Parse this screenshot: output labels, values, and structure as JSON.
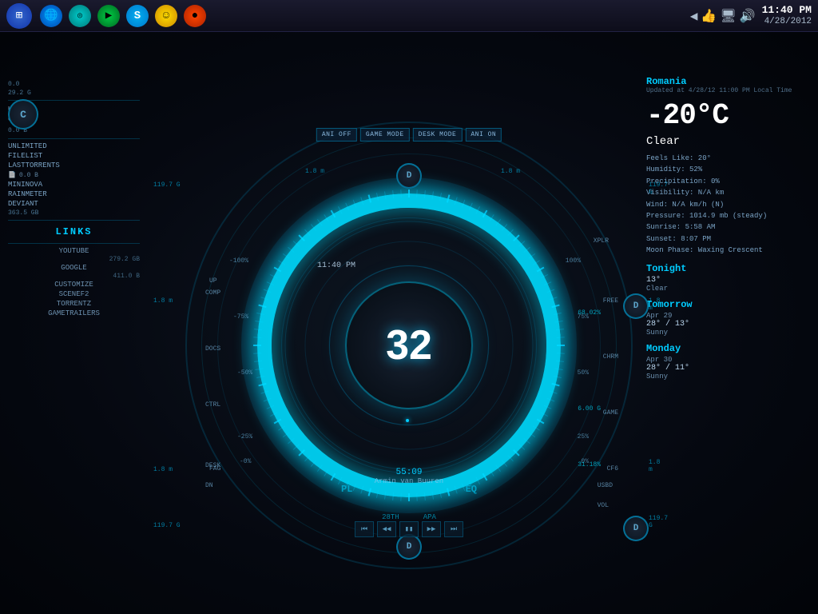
{
  "taskbar": {
    "start_icon": "⊞",
    "icons": [
      {
        "name": "ie-icon",
        "symbol": "🌐",
        "color": "blue"
      },
      {
        "name": "app2-icon",
        "symbol": "◎",
        "color": "teal"
      },
      {
        "name": "play-icon",
        "symbol": "▶",
        "color": "green"
      },
      {
        "name": "skype-icon",
        "symbol": "S",
        "color": "skype"
      },
      {
        "name": "emoji-icon",
        "symbol": "☺",
        "color": "yellow"
      },
      {
        "name": "record-icon",
        "symbol": "●",
        "color": "red"
      }
    ]
  },
  "clock": {
    "time": "11:40 PM",
    "date": "4/28/2012"
  },
  "hud": {
    "center_number": "32",
    "time_display": "11:40  PM",
    "track_time": "55:09",
    "track_artist": "Armin van Buuren",
    "track_title": "28TH  APA",
    "buttons": [
      {
        "label": "ANI OFF"
      },
      {
        "label": "GAME MODE"
      },
      {
        "label": "DESK MODE"
      },
      {
        "label": "ANI ON"
      }
    ],
    "left_labels": {
      "comp": "COMP",
      "docs": "DOCS",
      "ctrl": "CTRL",
      "fag": "FAG",
      "dn": "DN",
      "desk": "DESK",
      "up": "UP"
    },
    "right_labels": {
      "xplr": "XPLR",
      "chrm": "CHRM",
      "game": "GAME",
      "cf6": "CF6",
      "usbd": "USBD",
      "vol": "VOL",
      "free": "FREE"
    },
    "d_circles": [
      {
        "pos": "top",
        "label": "D"
      },
      {
        "pos": "right-top",
        "label": "D"
      },
      {
        "pos": "right-bottom",
        "label": "D"
      },
      {
        "pos": "bottom",
        "label": "D"
      }
    ],
    "c_circle": {
      "label": "C"
    },
    "size_labels": {
      "val1": "1.8 m",
      "val2": "119.7 G",
      "val3": "29.2 G",
      "val4": "0.0",
      "val5": "0.0 B",
      "val6": "363.5 GB",
      "val7": "279.2 GB",
      "val8": "411.0 B",
      "val9": "6.00 G",
      "val10": "68.02%",
      "val11": "31.18%"
    },
    "pct_markers": {
      "p100_1": "100%",
      "p75": "75%",
      "p50": "50%",
      "p25": "25%",
      "p0": "0%",
      "pm50": "-50%",
      "pm75": "-75%",
      "pm100": "-100%",
      "pm25": "-25%"
    },
    "pl_label": "PL",
    "eq_label": "EQ",
    "bottom_labels": [
      "28TH",
      "APA"
    ],
    "media_controls": [
      "⏮",
      "◀◀",
      "▮▮",
      "▶▶",
      "⏭"
    ]
  },
  "left_panel": {
    "items": [
      {
        "label": "UNLIMITED"
      },
      {
        "label": "FILELIST"
      },
      {
        "label": "LASTTORRENTS"
      },
      {
        "label": "MININOVA"
      },
      {
        "label": "RAINMETER"
      },
      {
        "label": "DEVIANT"
      },
      {
        "size": "363.5 GB"
      }
    ],
    "links_title": "Links",
    "links": [
      {
        "label": "YOUTUBE"
      },
      {
        "label": "GOOGLE"
      },
      {
        "label": "CUSTOMIZE"
      },
      {
        "label": "SCENEF2"
      },
      {
        "label": "TORRENTZ"
      },
      {
        "label": "GAMETRAILERS"
      }
    ],
    "stats": [
      {
        "label": "0.0",
        "value": ""
      },
      {
        "label": "29.2 G",
        "value": ""
      },
      {
        "label": "0.0 B",
        "value": ""
      },
      {
        "label": "363.5 GB",
        "value": ""
      },
      {
        "label": "279.2 GB",
        "value": ""
      },
      {
        "label": "411.0 B",
        "value": ""
      }
    ]
  },
  "weather": {
    "location": "Romania",
    "updated": "Updated at 4/28/12 11:00 PM Local Time",
    "temperature": "-20°C",
    "condition": "Clear",
    "details": {
      "feels_like": "Feels Like: 20°",
      "humidity": "Humidity: 52%",
      "precipitation": "Precipitation: 0%",
      "visibility": "Visibility: N/A km",
      "wind": "Wind: N/A km/h (N)",
      "pressure": "Pressure: 1014.9 mb (steady)",
      "sunrise": "Sunrise: 5:58 AM",
      "sunset": "Sunset: 8:07 PM",
      "moon": "Moon Phase: Waxing Crescent"
    },
    "tonight": {
      "title": "Tonight",
      "temp": "13°",
      "condition": "Clear"
    },
    "tomorrow": {
      "title": "Tomorrow",
      "date": "Apr 29",
      "temp": "28° / 13°",
      "condition": "Sunny"
    },
    "monday": {
      "title": "Monday",
      "date": "Apr 30",
      "temp": "28° / 11°",
      "condition": "Sunny"
    }
  }
}
